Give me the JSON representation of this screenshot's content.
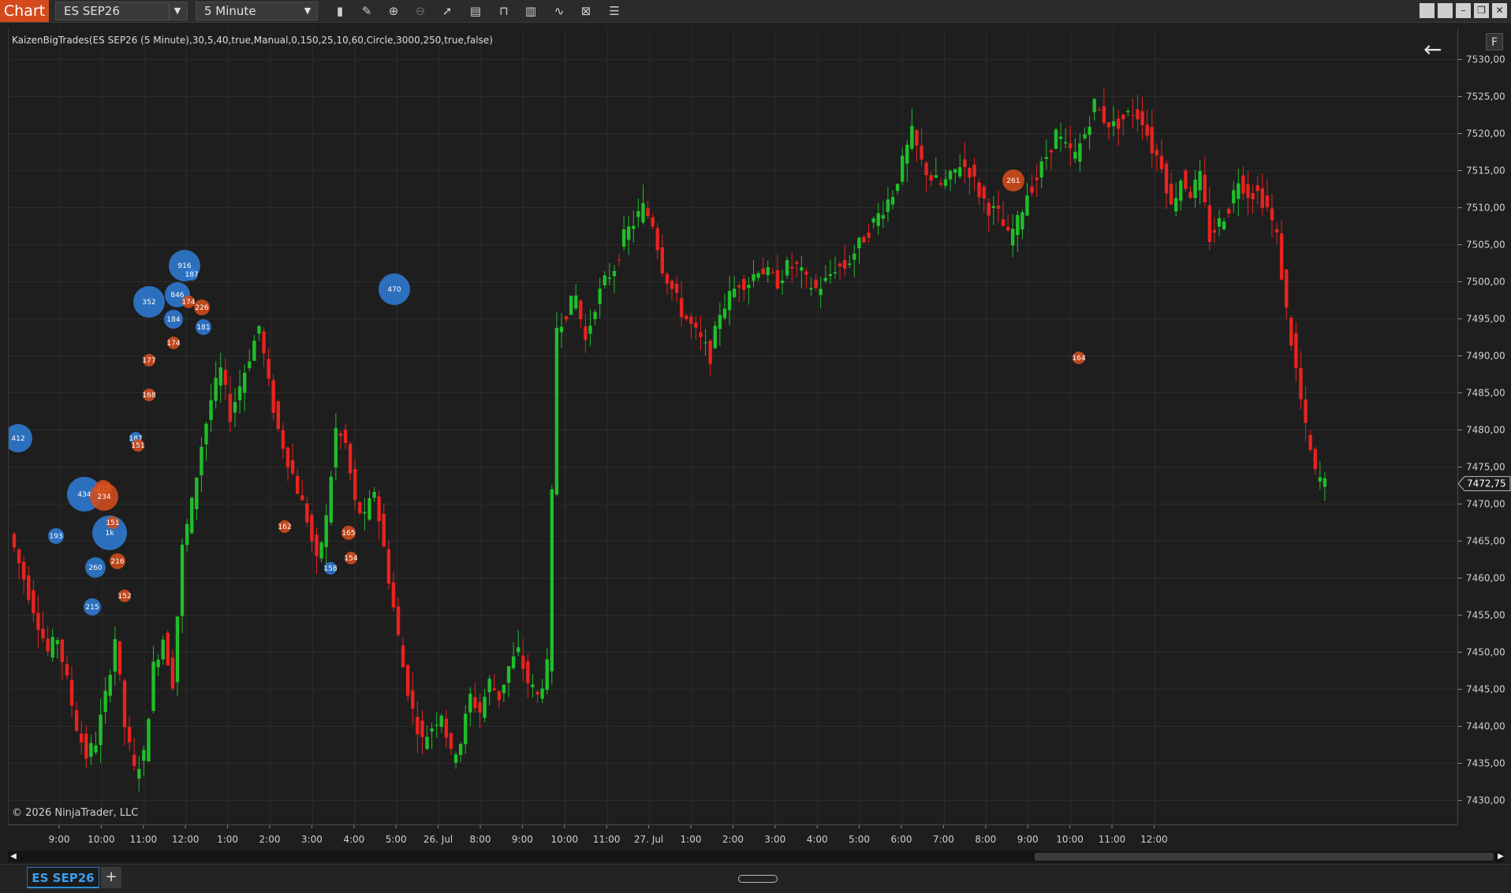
{
  "toolbar": {
    "app_title": "Chart",
    "instrument": "ES SEP26",
    "period": "5 Minute",
    "icons": [
      "bar-type-icon",
      "pencil-icon",
      "zoom-in-icon",
      "zoom-out-icon",
      "pointer-icon",
      "data-box-icon",
      "properties-icon",
      "strategies-icon",
      "indicators-icon",
      "templates-icon",
      "list-icon"
    ]
  },
  "window_controls": [
    "tile-icon",
    "tile-icon",
    "minimize-icon",
    "restore-icon",
    "close-icon"
  ],
  "chart": {
    "indicator_label": "KaizenBigTrades(ES SEP26 (5 Minute),30,5,40,true,Manual,0,150,25,10,60,Circle,3000,250,true,false)",
    "copyright": "© 2026 NinjaTrader, LLC",
    "f_button": "F",
    "current_price": "7472,75",
    "colors": {
      "up": "#1fbe2a",
      "down": "#e8231e",
      "buy_bubble": "#2f7bd4",
      "sell_bubble": "#d44d1c",
      "background": "#1e1e1e",
      "grid": "#2c2c2c"
    }
  },
  "chart_data": {
    "type": "candlestick",
    "instrument": "ES SEP26",
    "interval": "5 Minute",
    "y_ticks": [
      "7530,00",
      "7525,00",
      "7520,00",
      "7515,00",
      "7510,00",
      "7505,00",
      "7500,00",
      "7495,00",
      "7490,00",
      "7485,00",
      "7480,00",
      "7475,00",
      "7470,00",
      "7465,00",
      "7460,00",
      "7455,00",
      "7450,00",
      "7445,00",
      "7440,00",
      "7435,00",
      "7430,00"
    ],
    "ylim": [
      7427.5,
      7532.5
    ],
    "x_ticks": [
      "9:00",
      "10:00",
      "11:00",
      "12:00",
      "1:00",
      "2:00",
      "3:00",
      "4:00",
      "5:00",
      "26. Jul",
      "8:00",
      "9:00",
      "10:00",
      "11:00",
      "27. Jul",
      "1:00",
      "2:00",
      "3:00",
      "4:00",
      "5:00",
      "6:00",
      "7:00",
      "8:00",
      "9:00",
      "10:00",
      "11:00",
      "12:00"
    ],
    "price_path": [
      [
        0,
        7466
      ],
      [
        2,
        7462
      ],
      [
        4,
        7458
      ],
      [
        6,
        7454
      ],
      [
        8,
        7450
      ],
      [
        10,
        7452
      ],
      [
        12,
        7446
      ],
      [
        14,
        7440
      ],
      [
        16,
        7436
      ],
      [
        18,
        7438
      ],
      [
        20,
        7444
      ],
      [
        22,
        7452
      ],
      [
        24,
        7440
      ],
      [
        26,
        7434
      ],
      [
        28,
        7436
      ],
      [
        30,
        7448
      ],
      [
        32,
        7452
      ],
      [
        34,
        7446
      ],
      [
        36,
        7464
      ],
      [
        38,
        7470
      ],
      [
        40,
        7478
      ],
      [
        42,
        7484
      ],
      [
        44,
        7488
      ],
      [
        46,
        7482
      ],
      [
        48,
        7486
      ],
      [
        50,
        7490
      ],
      [
        52,
        7494
      ],
      [
        54,
        7486
      ],
      [
        56,
        7480
      ],
      [
        58,
        7476
      ],
      [
        60,
        7472
      ],
      [
        62,
        7468
      ],
      [
        64,
        7462
      ],
      [
        66,
        7468
      ],
      [
        68,
        7480
      ],
      [
        70,
        7478
      ],
      [
        72,
        7470
      ],
      [
        74,
        7468
      ],
      [
        76,
        7472
      ],
      [
        78,
        7464
      ],
      [
        80,
        7456
      ],
      [
        82,
        7448
      ],
      [
        84,
        7442
      ],
      [
        86,
        7438
      ],
      [
        88,
        7440
      ],
      [
        90,
        7442
      ],
      [
        92,
        7436
      ],
      [
        94,
        7438
      ],
      [
        96,
        7444
      ],
      [
        98,
        7442
      ],
      [
        100,
        7446
      ],
      [
        102,
        7444
      ],
      [
        104,
        7448
      ],
      [
        106,
        7450
      ],
      [
        108,
        7446
      ],
      [
        110,
        7444
      ],
      [
        112,
        7448
      ],
      [
        114,
        7494
      ],
      [
        116,
        7496
      ],
      [
        118,
        7498
      ],
      [
        120,
        7492
      ],
      [
        122,
        7497
      ],
      [
        124,
        7500
      ],
      [
        126,
        7502
      ],
      [
        128,
        7506
      ],
      [
        130,
        7508
      ],
      [
        132,
        7510
      ],
      [
        134,
        7508
      ],
      [
        136,
        7502
      ],
      [
        138,
        7499
      ],
      [
        140,
        7496
      ],
      [
        142,
        7494
      ],
      [
        144,
        7492
      ],
      [
        146,
        7490
      ],
      [
        148,
        7496
      ],
      [
        150,
        7498
      ],
      [
        152,
        7500
      ],
      [
        154,
        7500
      ],
      [
        156,
        7502
      ],
      [
        158,
        7501
      ],
      [
        160,
        7500
      ],
      [
        162,
        7502
      ],
      [
        164,
        7502
      ],
      [
        166,
        7500
      ],
      [
        168,
        7499
      ],
      [
        170,
        7500
      ],
      [
        172,
        7502
      ],
      [
        174,
        7502
      ],
      [
        176,
        7504
      ],
      [
        178,
        7506
      ],
      [
        180,
        7508
      ],
      [
        182,
        7510
      ],
      [
        184,
        7512
      ],
      [
        186,
        7516
      ],
      [
        188,
        7520
      ],
      [
        190,
        7516
      ],
      [
        192,
        7514
      ],
      [
        194,
        7513
      ],
      [
        196,
        7514
      ],
      [
        198,
        7516
      ],
      [
        200,
        7515
      ],
      [
        202,
        7512
      ],
      [
        204,
        7510
      ],
      [
        206,
        7509
      ],
      [
        208,
        7506
      ],
      [
        210,
        7508
      ],
      [
        212,
        7512
      ],
      [
        214,
        7514
      ],
      [
        216,
        7517
      ],
      [
        218,
        7520
      ],
      [
        220,
        7518
      ],
      [
        222,
        7517
      ],
      [
        224,
        7520
      ],
      [
        226,
        7524
      ],
      [
        228,
        7522
      ],
      [
        230,
        7521
      ],
      [
        232,
        7522
      ],
      [
        234,
        7523
      ],
      [
        236,
        7522
      ],
      [
        238,
        7518
      ],
      [
        240,
        7516
      ],
      [
        242,
        7510
      ],
      [
        244,
        7514
      ],
      [
        246,
        7512
      ],
      [
        248,
        7514
      ],
      [
        250,
        7506
      ],
      [
        252,
        7508
      ],
      [
        254,
        7510
      ],
      [
        256,
        7514
      ],
      [
        258,
        7512
      ],
      [
        260,
        7512
      ],
      [
        262,
        7510
      ],
      [
        264,
        7506
      ],
      [
        266,
        7496
      ],
      [
        268,
        7488
      ],
      [
        270,
        7480
      ],
      [
        272,
        7474
      ],
      [
        274,
        7472.75
      ]
    ],
    "big_trades": [
      {
        "label": "412",
        "side": "buy"
      },
      {
        "label": "193",
        "side": "buy"
      },
      {
        "label": "434",
        "side": "buy"
      },
      {
        "label": "260",
        "side": "buy"
      },
      {
        "label": "215",
        "side": "buy"
      },
      {
        "label": "1k",
        "side": "buy"
      },
      {
        "label": "213",
        "side": "sell"
      },
      {
        "label": "234",
        "side": "sell"
      },
      {
        "label": "151",
        "side": "sell"
      },
      {
        "label": "216",
        "side": "sell"
      },
      {
        "label": "152",
        "side": "sell"
      },
      {
        "label": "187",
        "side": "buy"
      },
      {
        "label": "151",
        "side": "sell"
      },
      {
        "label": "168",
        "side": "sell"
      },
      {
        "label": "177",
        "side": "sell"
      },
      {
        "label": "352",
        "side": "buy"
      },
      {
        "label": "184",
        "side": "buy"
      },
      {
        "label": "174",
        "side": "sell"
      },
      {
        "label": "846",
        "side": "buy"
      },
      {
        "label": "916",
        "side": "buy"
      },
      {
        "label": "187",
        "side": "buy"
      },
      {
        "label": "174",
        "side": "sell"
      },
      {
        "label": "226",
        "side": "sell"
      },
      {
        "label": "181",
        "side": "buy"
      },
      {
        "label": "162",
        "side": "sell"
      },
      {
        "label": "158",
        "side": "buy"
      },
      {
        "label": "165",
        "side": "sell"
      },
      {
        "label": "154",
        "side": "sell"
      },
      {
        "label": "470",
        "side": "buy"
      },
      {
        "label": "261",
        "side": "sell"
      },
      {
        "label": "164",
        "side": "sell"
      }
    ]
  },
  "tabs": {
    "active": "ES SEP26",
    "add": "+"
  }
}
